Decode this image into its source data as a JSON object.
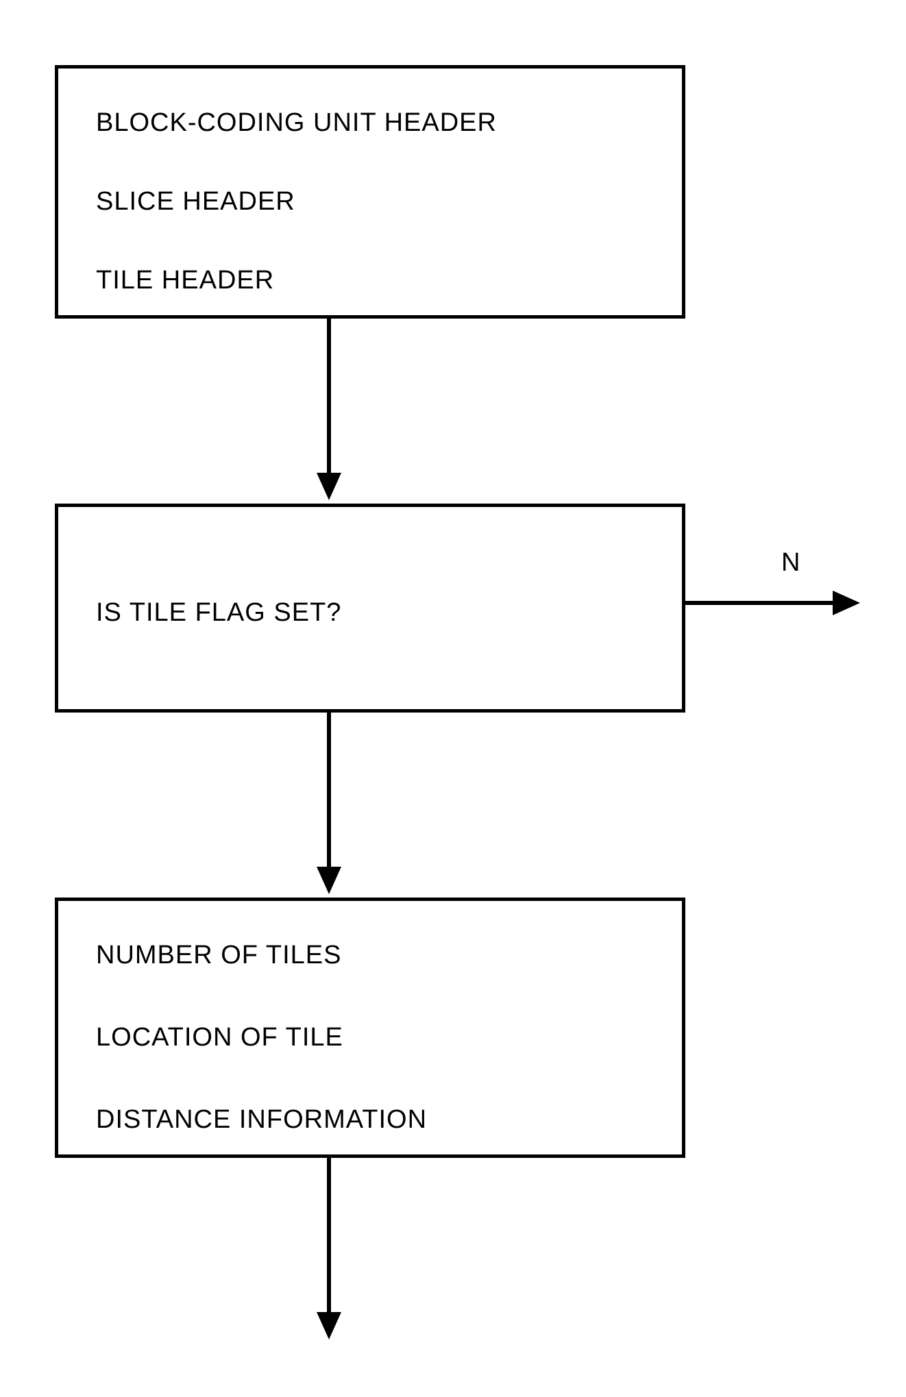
{
  "chart_data": {
    "type": "flowchart",
    "nodes": [
      {
        "id": "box1",
        "type": "process",
        "lines": [
          "BLOCK-CODING UNIT HEADER",
          "SLICE HEADER",
          "TILE HEADER"
        ]
      },
      {
        "id": "box2",
        "type": "decision",
        "lines": [
          "IS TILE FLAG SET?"
        ]
      },
      {
        "id": "box3",
        "type": "process",
        "lines": [
          "NUMBER OF TILES",
          "LOCATION OF TILE",
          "DISTANCE INFORMATION"
        ]
      }
    ],
    "edges": [
      {
        "from": "box1",
        "to": "box2",
        "label": ""
      },
      {
        "from": "box2",
        "to": "exit-right",
        "label": "N"
      },
      {
        "from": "box2",
        "to": "box3",
        "label": ""
      },
      {
        "from": "box3",
        "to": "exit-down",
        "label": ""
      }
    ]
  },
  "box1": {
    "line0": "BLOCK-CODING UNIT HEADER",
    "line1": "SLICE HEADER",
    "line2": "TILE HEADER"
  },
  "box2": {
    "line0": "IS TILE FLAG SET?"
  },
  "box3": {
    "line0": "NUMBER OF TILES",
    "line1": "LOCATION OF TILE",
    "line2": "DISTANCE INFORMATION"
  },
  "labels": {
    "n": "N"
  }
}
